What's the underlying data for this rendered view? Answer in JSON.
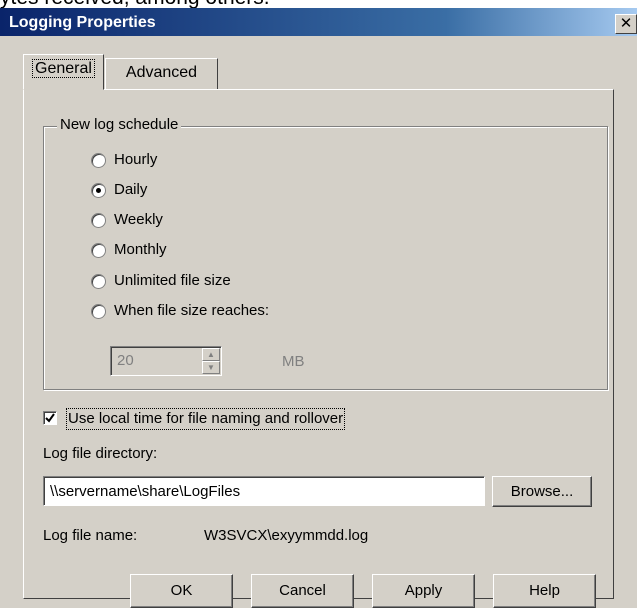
{
  "caption_above": "ytes received, among others.",
  "window": {
    "title": "Logging Properties",
    "close_glyph": "✕"
  },
  "tabs": [
    {
      "label": "General",
      "selected": true
    },
    {
      "label": "Advanced",
      "selected": false
    }
  ],
  "schedule": {
    "group_label": "New log schedule",
    "options": [
      {
        "label": "Hourly",
        "selected": false
      },
      {
        "label": "Daily",
        "selected": true
      },
      {
        "label": "Weekly",
        "selected": false
      },
      {
        "label": "Monthly",
        "selected": false
      },
      {
        "label": "Unlimited file size",
        "selected": false
      },
      {
        "label": "When file size reaches:",
        "selected": false
      }
    ],
    "size_value": "20",
    "size_unit": "MB"
  },
  "local_time": {
    "label": "Use local time for file naming and rollover",
    "checked": true
  },
  "directory": {
    "label": "Log file directory:",
    "value": "\\\\servername\\share\\LogFiles",
    "browse_label": "Browse..."
  },
  "file_name": {
    "label": "Log file name:",
    "value": "W3SVCX\\exyymmdd.log"
  },
  "buttons": {
    "ok": "OK",
    "cancel": "Cancel",
    "apply": "Apply",
    "help": "Help"
  }
}
